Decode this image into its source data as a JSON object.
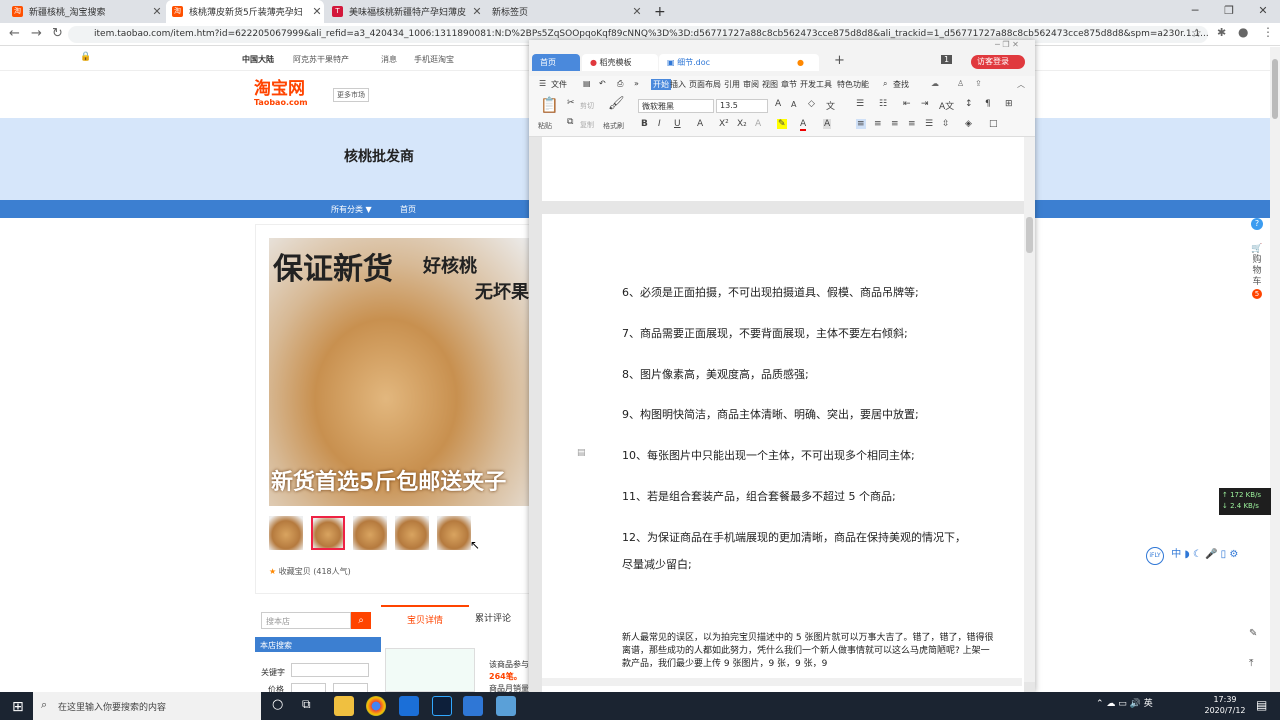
{
  "chrome": {
    "tabs": [
      {
        "label": "新疆核桃_淘宝搜索",
        "color": "#ff5000",
        "glyph": "淘"
      },
      {
        "label": "核桃薄皮新货5斤装薄壳孕妇",
        "color": "#ff5000",
        "glyph": "淘"
      },
      {
        "label": "美味福核桃新疆特产孕妇薄皮",
        "color": "#d3173b",
        "glyph": "T"
      },
      {
        "label": "新标签页",
        "color": "#8ab4f8",
        "glyph": ""
      }
    ],
    "new_tab": "+",
    "url": "item.taobao.com/item.htm?id=622205067999&ali_refid=a3_420434_1006:1311890081:N:D%2BPs5ZqSOOpqoKqf89cNNQ%3D%3D:d56771727a88c8cb562473cce875d8d8&ali_trackid=1_d56771727a88c8cb562473cce875d8d8&spm=a230r.1.1..."
  },
  "taobao": {
    "top_links": [
      "中国大陆",
      "阿克苏干果特产",
      "消息",
      "手机逛淘宝"
    ],
    "logo_cn": "淘宝网",
    "logo_en": "Taobao.com",
    "market": "更多市场",
    "shop_name": "核桃批发商",
    "nav": [
      "所有分类 ▼",
      "首页"
    ],
    "product_text": {
      "big": "保证新货",
      "sub1": "好核桃",
      "sub2": "无坏果",
      "bottom": "新货首选5斤包邮送夹子"
    },
    "favorite": "收藏宝贝 (418人气)",
    "shop_search_placeholder": "搜本店",
    "shop_search_section": "本店搜索",
    "keyword_label": "关键字",
    "price_label": "价格",
    "detail_tab": "宝贝详情",
    "review_tab": "累计评论",
    "promo_1": "该商品参与",
    "promo_2": "264笔。",
    "promo_3": "商品月销量"
  },
  "wps": {
    "tabs": [
      "首页",
      "稻壳模板",
      "细节.doc"
    ],
    "login": "访客登录",
    "menu": [
      "文件",
      "开始",
      "插入",
      "页面布局",
      "引用",
      "审阅",
      "视图",
      "章节",
      "开发工具",
      "特色功能",
      "查找"
    ],
    "ribbon": {
      "paste": "粘贴",
      "cut": "剪切",
      "copy": "复制",
      "format_painter": "格式刷",
      "font": "微软雅黑",
      "size": "13.5"
    },
    "doc_lines": [
      "6、必须是正面拍摄，不可出现拍摄道具、假模、商品吊牌等;",
      "7、商品需要正面展现，不要背面展现，主体不要左右倾斜;",
      "8、图片像素高，美观度高，品质感强;",
      "9、构图明快简洁，商品主体清晰、明确、突出，要居中放置;",
      "10、每张图片中只能出现一个主体，不可出现多个相同主体;",
      "11、若是组合套装产品，组合套餐最多不超过 5 个商品;",
      "12、为保证商品在手机端展现的更加清晰，商品在保持美观的情况下，",
      "尽量减少留白;"
    ],
    "small_paragraph": "新人最常见的误区，以为拍完宝贝描述中的 5 张图片就可以万事大吉了。错了，错了，错得很离谱，那些成功的人都如此努力，凭什么我们一个新人做事情就可以这么马虎简陋呢? 上架一款产品，我们最少要上传 9 张图片，9 张，9 张，9"
  },
  "side": {
    "cart": "购物车",
    "cart_count": "5",
    "speed_up": "↑ 172 KB/s",
    "speed_down": "↓ 2.4 KB/s",
    "ime": "中"
  },
  "taskbar": {
    "search": "在这里输入你要搜索的内容",
    "time": "17:39",
    "date": "2020/7/12"
  }
}
